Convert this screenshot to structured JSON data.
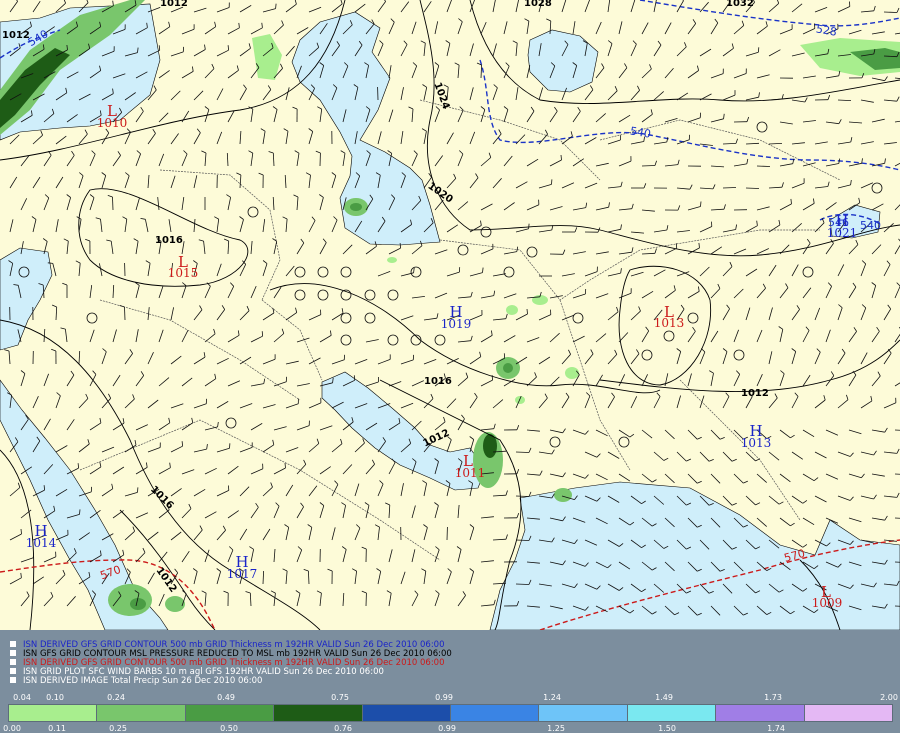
{
  "colors": {
    "land": "#fdfbd8",
    "water": "#cfeefa",
    "thickness_540": "#1a33c7",
    "thickness_570": "#cc1a1a",
    "isobar": "#000000",
    "high": "#1a24c8",
    "low": "#cc1a1a",
    "legend_bg": "#7c8e9e"
  },
  "map": {
    "highs": [
      {
        "symbol": "H",
        "value": "1019"
      },
      {
        "symbol": "H",
        "value": "1013"
      },
      {
        "symbol": "H",
        "value": "1014"
      },
      {
        "symbol": "H",
        "value": "1017"
      },
      {
        "symbol": "H",
        "value": "1021"
      }
    ],
    "lows": [
      {
        "symbol": "L",
        "value": "1010"
      },
      {
        "symbol": "L",
        "value": "1015"
      },
      {
        "symbol": "L",
        "value": "1013"
      },
      {
        "symbol": "L",
        "value": "1011"
      },
      {
        "symbol": "L",
        "value": "1009"
      }
    ],
    "isobar_labels": [
      "1012",
      "1028",
      "1032",
      "1012",
      "1024",
      "1020",
      "1016",
      "1016",
      "1012",
      "1012",
      "1016",
      "1012"
    ],
    "thickness_labels_540": [
      "540",
      "540",
      "528",
      "546",
      "540"
    ],
    "thickness_labels_570": [
      "570",
      "570"
    ]
  },
  "legend": {
    "lines": [
      {
        "text": "ISN DERIVED GFS GRID CONTOUR 500 mb GRID Thickness m 192HR VALID Sun 26 Dec 2010 06:00",
        "color": "#1a24c8"
      },
      {
        "text": "ISN GFS GRID CONTOUR MSL PRESSURE REDUCED TO MSL mb 192HR VALID Sun 26 Dec 2010 06:00",
        "color": "#000000"
      },
      {
        "text": "ISN DERIVED GFS GRID CONTOUR 500 mb GRID Thickness m 192HR VALID Sun 26 Dec 2010 06:00",
        "color": "#cc1a1a"
      },
      {
        "text": "ISN GRID PLOT SFC WIND BARBS 10 m agl GFS 192HR VALID Sun 26 Dec 2010 06:00",
        "color": "#ffffff"
      },
      {
        "text": "ISN DERIVED IMAGE Total Precip Sun 26 Dec 2010 06:00",
        "color": "#ffffff"
      }
    ],
    "scale_top": [
      "0.04",
      "0.10",
      "0.24",
      "0.49",
      "0.75",
      "0.99",
      "1.24",
      "1.49",
      "1.73",
      "2.00"
    ],
    "scale_bottom": [
      "0.00",
      "0.11",
      "0.25",
      "0.50",
      "0.76",
      "0.99",
      "1.25",
      "1.50",
      "1.74"
    ],
    "scale_colors": [
      "#a8ee8e",
      "#79c66c",
      "#4a9c44",
      "#1e5c16",
      "#1c4eaa",
      "#3a84e4",
      "#6ec4f8",
      "#7ae8f0",
      "#a07ee6",
      "#e4b8f4"
    ]
  }
}
